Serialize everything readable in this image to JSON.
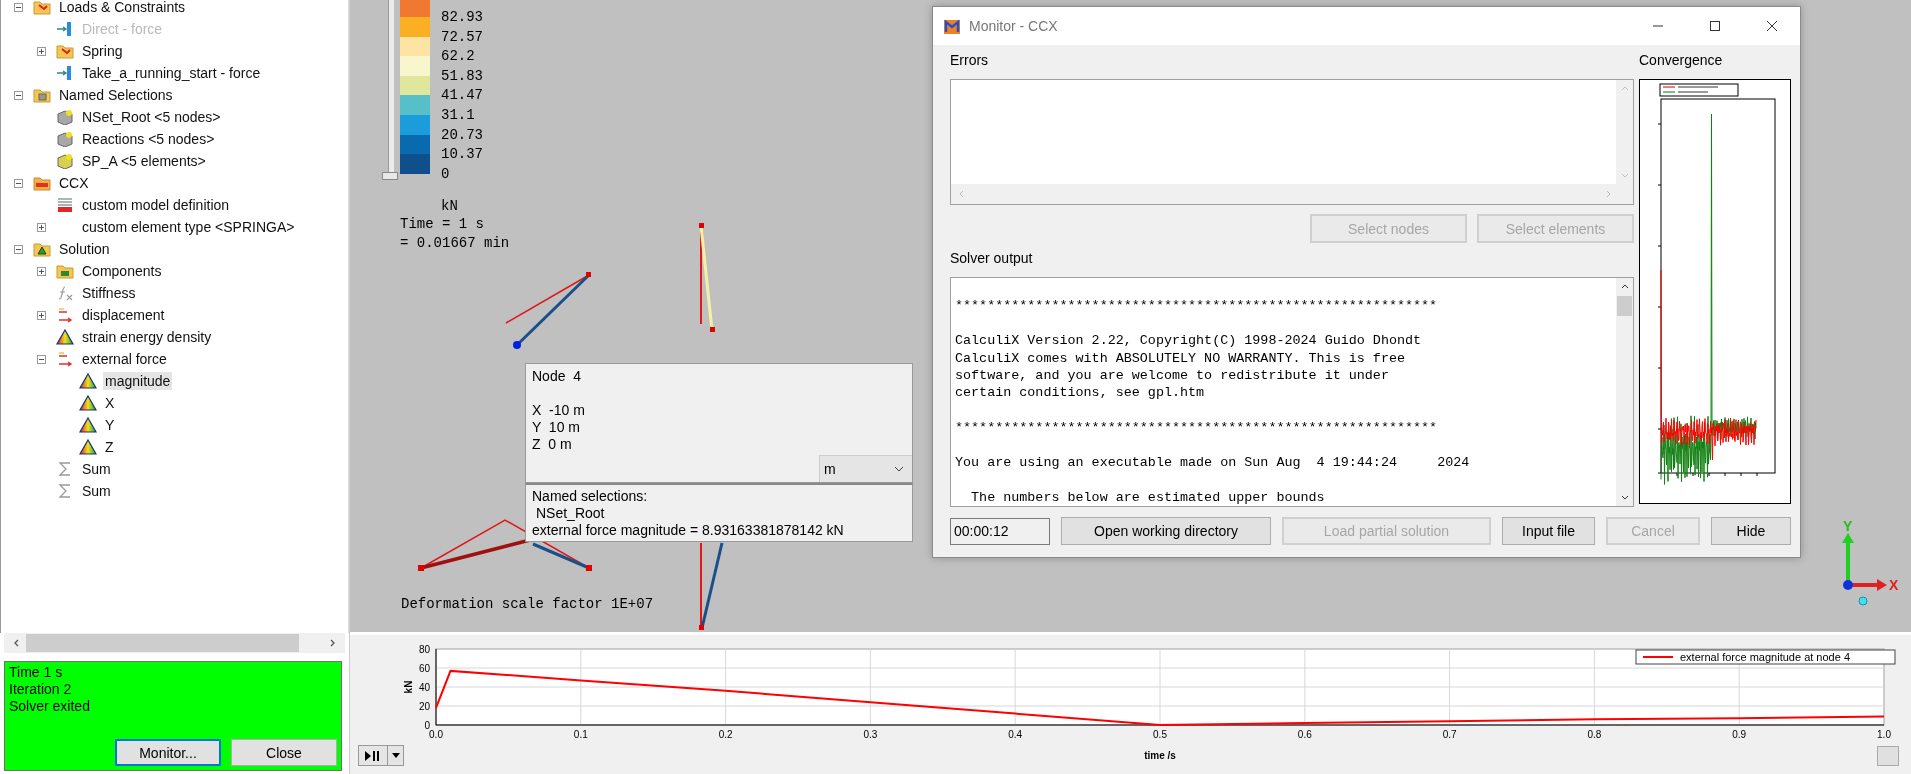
{
  "tree": {
    "items": [
      {
        "label": "Loads & Constraints",
        "kind": "load-folder",
        "expanded": true,
        "selected": false,
        "disabled": false,
        "children": [
          {
            "label": "Direct - force",
            "kind": "force",
            "selected": false,
            "disabled": true
          },
          {
            "label": "Spring",
            "kind": "load-folder",
            "expanded": false,
            "selected": false,
            "disabled": false
          },
          {
            "label": "Take_a_running_start - force",
            "kind": "force",
            "selected": false,
            "disabled": false
          }
        ]
      },
      {
        "label": "Named Selections",
        "kind": "selection-folder",
        "expanded": true,
        "selected": false,
        "disabled": false,
        "children": [
          {
            "label": "NSet_Root <5 nodes>",
            "kind": "node-set",
            "selected": false,
            "disabled": false
          },
          {
            "label": "Reactions <5 nodes>",
            "kind": "node-set",
            "selected": false,
            "disabled": false
          },
          {
            "label": "SP_A <5 elements>",
            "kind": "element-set",
            "selected": false,
            "disabled": false
          }
        ]
      },
      {
        "label": "CCX",
        "kind": "ccx-folder",
        "expanded": true,
        "selected": false,
        "disabled": false,
        "children": [
          {
            "label": "custom model definition",
            "kind": "ccx-definition",
            "selected": false,
            "disabled": false
          },
          {
            "label": "custom element type <SPRINGA>",
            "kind": "plain",
            "expanded": false,
            "selected": false,
            "disabled": false
          }
        ]
      },
      {
        "label": "Solution",
        "kind": "solution-folder",
        "expanded": true,
        "selected": false,
        "disabled": false,
        "children": [
          {
            "label": "Components",
            "kind": "components-folder",
            "expanded": false,
            "selected": false,
            "disabled": false
          },
          {
            "label": "Stiffness",
            "kind": "function",
            "selected": false,
            "disabled": false
          },
          {
            "label": "displacement",
            "kind": "vector",
            "expanded": false,
            "selected": false,
            "disabled": false
          },
          {
            "label": "strain energy density",
            "kind": "contour",
            "selected": false,
            "disabled": false
          },
          {
            "label": "external force",
            "kind": "vector",
            "expanded": true,
            "selected": false,
            "disabled": false,
            "children": [
              {
                "label": "magnitude",
                "kind": "contour",
                "selected": true,
                "disabled": false
              },
              {
                "label": "X",
                "kind": "contour",
                "selected": false,
                "disabled": false
              },
              {
                "label": "Y",
                "kind": "contour",
                "selected": false,
                "disabled": false
              },
              {
                "label": "Z",
                "kind": "contour",
                "selected": false,
                "disabled": false
              }
            ]
          },
          {
            "label": "Sum",
            "kind": "sum",
            "selected": false,
            "disabled": false
          },
          {
            "label": "Sum",
            "kind": "sum",
            "selected": false,
            "disabled": false
          }
        ]
      }
    ]
  },
  "status_panel": {
    "lines": [
      "Time 1 s",
      "Iteration 2",
      "Solver exited"
    ],
    "buttons": [
      {
        "label": "Monitor...",
        "focused": true
      },
      {
        "label": "Close",
        "focused": false
      }
    ]
  },
  "viewport": {
    "legend": {
      "slider": {
        "level": 0
      },
      "bands": [
        {
          "color": "#f07830",
          "label": "82.93"
        },
        {
          "color": "#fbb024",
          "label": "72.57"
        },
        {
          "color": "#fde3a4",
          "label": "62.2"
        },
        {
          "color": "#f7f6cc",
          "label": "51.83"
        },
        {
          "color": "#e0e69c",
          "label": "41.47"
        },
        {
          "color": "#56bfc8",
          "label": "31.1"
        },
        {
          "color": "#1b9ddc",
          "label": "20.73"
        },
        {
          "color": "#0a6ab0",
          "label": "10.37"
        },
        {
          "color": "#0f4f8c",
          "label": "0"
        }
      ],
      "unit": "kN"
    },
    "time_lines": [
      "Time = 1 s",
      "= 0.01667 min"
    ],
    "scale_note": "Deformation scale factor 1E+07",
    "probe": {
      "title": "Node  4",
      "coords": [
        "X  -10 m",
        "Y  10 m",
        "Z  0 m"
      ],
      "unit_select": "m",
      "selections_heading": "Named selections:",
      "selection": "NSet_Root",
      "result": "external force magnitude = 8.93163381878142 kN"
    },
    "axis_labels": {
      "y": "Y",
      "x": "X"
    }
  },
  "monitor": {
    "title": "Monitor - CCX",
    "errors_label": "Errors",
    "select_buttons": [
      {
        "label": "Select nodes",
        "disabled": true
      },
      {
        "label": "Select elements",
        "disabled": true
      }
    ],
    "output_label": "Solver output",
    "output_text": "\n************************************************************\n\nCalculiX Version 2.22, Copyright(C) 1998-2024 Guido Dhondt\nCalculiX comes with ABSOLUTELY NO WARRANTY. This is free\nsoftware, and you are welcome to redistribute it under\ncertain conditions, see gpl.htm\n\n************************************************************\n\nYou are using an executable made on Sun Aug  4 19:44:24     2024\n\n  The numbers below are estimated upper bounds",
    "elapsed": "00:00:12",
    "buttons": [
      {
        "label": "Open working directory",
        "disabled": false
      },
      {
        "label": "Load partial solution",
        "disabled": true
      },
      {
        "label": "Input file",
        "disabled": false
      },
      {
        "label": "Cancel",
        "disabled": true
      },
      {
        "label": "Hide",
        "disabled": false
      }
    ],
    "convergence_label": "Convergence"
  },
  "plot": {
    "chart_data": {
      "type": "line",
      "xlabel": "time /s",
      "ylabel": "kN",
      "grid": true,
      "x": [
        0,
        0.01,
        0.1,
        0.2,
        0.3,
        0.4,
        0.5,
        0.6,
        0.7,
        0.8,
        0.9,
        1.0
      ],
      "series": [
        {
          "name": "external force magnitude at node 4",
          "color": "#ff0000",
          "values": [
            18,
            57,
            47,
            36,
            24,
            12,
            0,
            2,
            4,
            6,
            7,
            9
          ]
        }
      ],
      "xlim": [
        0,
        1
      ],
      "ylim": [
        0,
        80
      ],
      "xticks": [
        {
          "value": 0,
          "label": "0.0"
        },
        {
          "value": 0.1,
          "label": "0.1"
        },
        {
          "value": 0.2,
          "label": "0.2"
        },
        {
          "value": 0.3,
          "label": "0.3"
        },
        {
          "value": 0.4,
          "label": "0.4"
        },
        {
          "value": 0.5,
          "label": "0.5"
        },
        {
          "value": 0.6,
          "label": "0.6"
        },
        {
          "value": 0.7,
          "label": "0.7"
        },
        {
          "value": 0.8,
          "label": "0.8"
        },
        {
          "value": 0.9,
          "label": "0.9"
        },
        {
          "value": 1,
          "label": "1.0"
        }
      ],
      "yticks": [
        0,
        20,
        40,
        60,
        80
      ]
    }
  }
}
